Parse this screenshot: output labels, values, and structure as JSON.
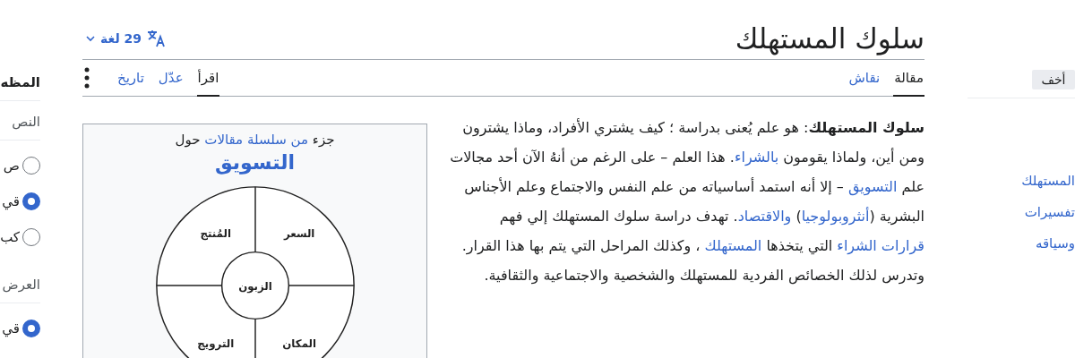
{
  "appearance_panel": {
    "title": "المظه",
    "sections": [
      {
        "heading": "النص",
        "options": [
          {
            "label": "ص",
            "selected": false
          },
          {
            "label": "قي",
            "selected": true
          },
          {
            "label": "كب",
            "selected": false
          }
        ]
      },
      {
        "heading": "العرض",
        "options": [
          {
            "label": "قي",
            "selected": true
          }
        ]
      }
    ]
  },
  "toc_panel": {
    "hide_button": "أخف",
    "items": [
      "المستهلك",
      "تفسيرات",
      "وسياقه"
    ]
  },
  "article": {
    "title": "سلوك المستهلك",
    "languages_button": "29 لغة",
    "namespace_tabs": [
      {
        "label": "مقالة",
        "selected": true
      },
      {
        "label": "نقاش",
        "selected": false
      }
    ],
    "view_tabs": [
      {
        "label": "اقرأ",
        "selected": true
      },
      {
        "label": "عدّل",
        "selected": false
      },
      {
        "label": "تاريخ",
        "selected": false
      }
    ],
    "paragraph": [
      {
        "kind": "bold",
        "text": "سلوك المستهلك"
      },
      {
        "kind": "text",
        "text": ": هو علم يُعنى بدراسة ؛ كيف يشتري الأفراد، وماذا يشترون ومن أين، ولماذا يقومون "
      },
      {
        "kind": "link",
        "text": "بالشراء"
      },
      {
        "kind": "text",
        "text": ". هذا العلم – على الرغم من أنهُ الآن أحد مجالات علم "
      },
      {
        "kind": "link",
        "text": "التسويق"
      },
      {
        "kind": "text",
        "text": " – إلا أنه استمد أساسياته من علم النفس والاجتماع وعلم الأجناس البشرية ("
      },
      {
        "kind": "link",
        "text": "أنثروبولوجيا"
      },
      {
        "kind": "text",
        "text": ") "
      },
      {
        "kind": "link",
        "text": "والاقتصاد"
      },
      {
        "kind": "text",
        "text": ". تهدف دراسة سلوك المستهلك إلي فهم "
      },
      {
        "kind": "link",
        "text": "قرارات الشراء"
      },
      {
        "kind": "text",
        "text": " التي يتخذها "
      },
      {
        "kind": "link",
        "text": "المستهلك"
      },
      {
        "kind": "text",
        "text": " ، وكذلك المراحل التي يتم بها هذا القرار. وتدرس لذلك الخصائص الفردية للمستهلك والشخصية والاجتماعية والثقافية."
      }
    ],
    "infobox": {
      "caption": [
        {
          "kind": "text",
          "text": "جزء "
        },
        {
          "kind": "link",
          "text": "من سلسلة مقالات"
        },
        {
          "kind": "text",
          "text": " حول"
        }
      ],
      "title": "التسويق",
      "diagram": {
        "center": "الزبون",
        "top_right": "السعر",
        "top_left": "المُنتج",
        "bottom_right": "المكان",
        "bottom_left": "الترويج"
      }
    }
  }
}
